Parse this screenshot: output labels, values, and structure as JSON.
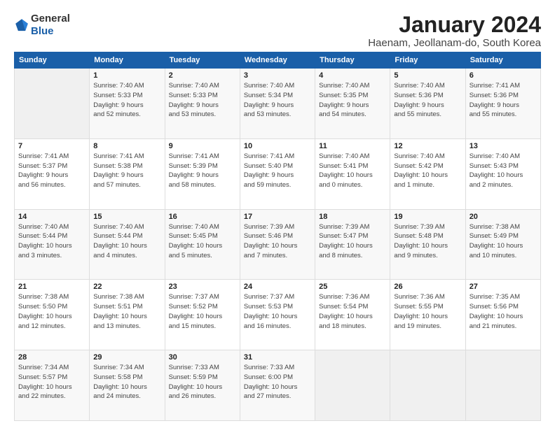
{
  "logo": {
    "general": "General",
    "blue": "Blue"
  },
  "title": "January 2024",
  "subtitle": "Haenam, Jeollanam-do, South Korea",
  "days_of_week": [
    "Sunday",
    "Monday",
    "Tuesday",
    "Wednesday",
    "Thursday",
    "Friday",
    "Saturday"
  ],
  "weeks": [
    [
      {
        "day": "",
        "info": ""
      },
      {
        "day": "1",
        "info": "Sunrise: 7:40 AM\nSunset: 5:33 PM\nDaylight: 9 hours\nand 52 minutes."
      },
      {
        "day": "2",
        "info": "Sunrise: 7:40 AM\nSunset: 5:33 PM\nDaylight: 9 hours\nand 53 minutes."
      },
      {
        "day": "3",
        "info": "Sunrise: 7:40 AM\nSunset: 5:34 PM\nDaylight: 9 hours\nand 53 minutes."
      },
      {
        "day": "4",
        "info": "Sunrise: 7:40 AM\nSunset: 5:35 PM\nDaylight: 9 hours\nand 54 minutes."
      },
      {
        "day": "5",
        "info": "Sunrise: 7:40 AM\nSunset: 5:36 PM\nDaylight: 9 hours\nand 55 minutes."
      },
      {
        "day": "6",
        "info": "Sunrise: 7:41 AM\nSunset: 5:36 PM\nDaylight: 9 hours\nand 55 minutes."
      }
    ],
    [
      {
        "day": "7",
        "info": "Sunrise: 7:41 AM\nSunset: 5:37 PM\nDaylight: 9 hours\nand 56 minutes."
      },
      {
        "day": "8",
        "info": "Sunrise: 7:41 AM\nSunset: 5:38 PM\nDaylight: 9 hours\nand 57 minutes."
      },
      {
        "day": "9",
        "info": "Sunrise: 7:41 AM\nSunset: 5:39 PM\nDaylight: 9 hours\nand 58 minutes."
      },
      {
        "day": "10",
        "info": "Sunrise: 7:41 AM\nSunset: 5:40 PM\nDaylight: 9 hours\nand 59 minutes."
      },
      {
        "day": "11",
        "info": "Sunrise: 7:40 AM\nSunset: 5:41 PM\nDaylight: 10 hours\nand 0 minutes."
      },
      {
        "day": "12",
        "info": "Sunrise: 7:40 AM\nSunset: 5:42 PM\nDaylight: 10 hours\nand 1 minute."
      },
      {
        "day": "13",
        "info": "Sunrise: 7:40 AM\nSunset: 5:43 PM\nDaylight: 10 hours\nand 2 minutes."
      }
    ],
    [
      {
        "day": "14",
        "info": "Sunrise: 7:40 AM\nSunset: 5:44 PM\nDaylight: 10 hours\nand 3 minutes."
      },
      {
        "day": "15",
        "info": "Sunrise: 7:40 AM\nSunset: 5:44 PM\nDaylight: 10 hours\nand 4 minutes."
      },
      {
        "day": "16",
        "info": "Sunrise: 7:40 AM\nSunset: 5:45 PM\nDaylight: 10 hours\nand 5 minutes."
      },
      {
        "day": "17",
        "info": "Sunrise: 7:39 AM\nSunset: 5:46 PM\nDaylight: 10 hours\nand 7 minutes."
      },
      {
        "day": "18",
        "info": "Sunrise: 7:39 AM\nSunset: 5:47 PM\nDaylight: 10 hours\nand 8 minutes."
      },
      {
        "day": "19",
        "info": "Sunrise: 7:39 AM\nSunset: 5:48 PM\nDaylight: 10 hours\nand 9 minutes."
      },
      {
        "day": "20",
        "info": "Sunrise: 7:38 AM\nSunset: 5:49 PM\nDaylight: 10 hours\nand 10 minutes."
      }
    ],
    [
      {
        "day": "21",
        "info": "Sunrise: 7:38 AM\nSunset: 5:50 PM\nDaylight: 10 hours\nand 12 minutes."
      },
      {
        "day": "22",
        "info": "Sunrise: 7:38 AM\nSunset: 5:51 PM\nDaylight: 10 hours\nand 13 minutes."
      },
      {
        "day": "23",
        "info": "Sunrise: 7:37 AM\nSunset: 5:52 PM\nDaylight: 10 hours\nand 15 minutes."
      },
      {
        "day": "24",
        "info": "Sunrise: 7:37 AM\nSunset: 5:53 PM\nDaylight: 10 hours\nand 16 minutes."
      },
      {
        "day": "25",
        "info": "Sunrise: 7:36 AM\nSunset: 5:54 PM\nDaylight: 10 hours\nand 18 minutes."
      },
      {
        "day": "26",
        "info": "Sunrise: 7:36 AM\nSunset: 5:55 PM\nDaylight: 10 hours\nand 19 minutes."
      },
      {
        "day": "27",
        "info": "Sunrise: 7:35 AM\nSunset: 5:56 PM\nDaylight: 10 hours\nand 21 minutes."
      }
    ],
    [
      {
        "day": "28",
        "info": "Sunrise: 7:34 AM\nSunset: 5:57 PM\nDaylight: 10 hours\nand 22 minutes."
      },
      {
        "day": "29",
        "info": "Sunrise: 7:34 AM\nSunset: 5:58 PM\nDaylight: 10 hours\nand 24 minutes."
      },
      {
        "day": "30",
        "info": "Sunrise: 7:33 AM\nSunset: 5:59 PM\nDaylight: 10 hours\nand 26 minutes."
      },
      {
        "day": "31",
        "info": "Sunrise: 7:33 AM\nSunset: 6:00 PM\nDaylight: 10 hours\nand 27 minutes."
      },
      {
        "day": "",
        "info": ""
      },
      {
        "day": "",
        "info": ""
      },
      {
        "day": "",
        "info": ""
      }
    ]
  ]
}
